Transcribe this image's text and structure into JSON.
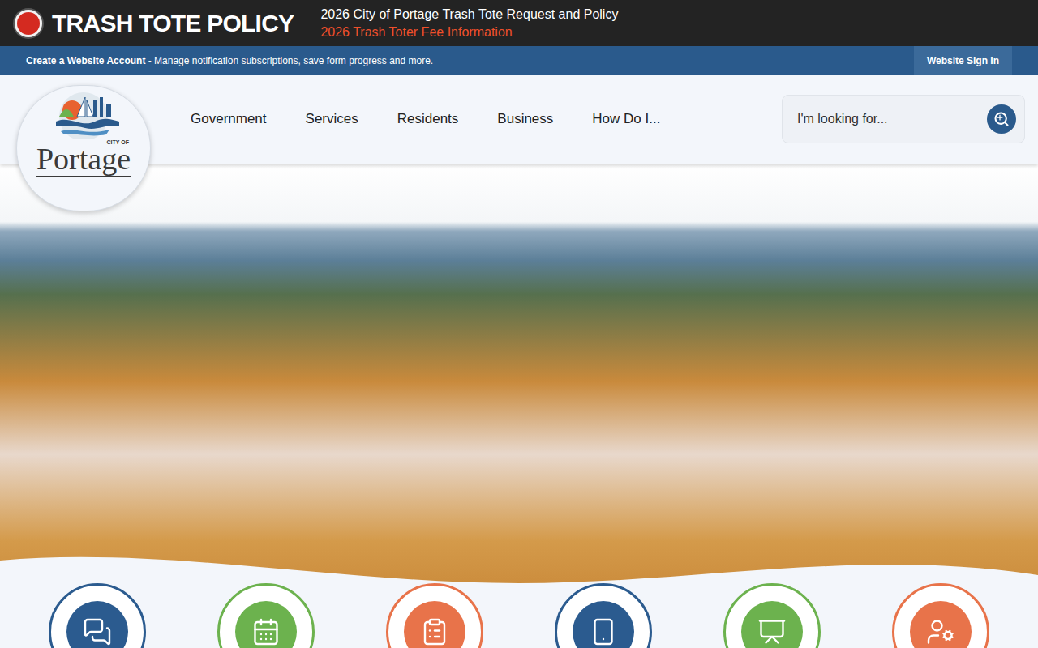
{
  "alert": {
    "label": "TRASH TOTE POLICY",
    "links": [
      "2026 City of Portage Trash Tote Request and Policy",
      "2026 Trash Toter Fee Information"
    ]
  },
  "account_bar": {
    "link": "Create a Website Account",
    "text": " - Manage notification subscriptions, save form progress and more.",
    "sign_in": "Website Sign In"
  },
  "logo": {
    "small": "CITY OF",
    "name": "Portage"
  },
  "nav": [
    {
      "label": "Government"
    },
    {
      "label": "Services"
    },
    {
      "label": "Residents"
    },
    {
      "label": "Business"
    },
    {
      "label": "How Do I..."
    }
  ],
  "search": {
    "placeholder": "I'm looking for..."
  },
  "tiles": [
    {
      "color": "#2b5b8f"
    },
    {
      "color": "#6cb24e"
    },
    {
      "color": "#e8734a"
    },
    {
      "color": "#2b5b8f"
    },
    {
      "color": "#6cb24e"
    },
    {
      "color": "#e8734a"
    }
  ]
}
